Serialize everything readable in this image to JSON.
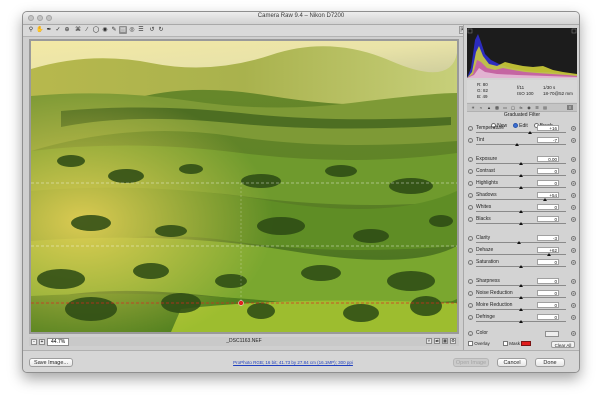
{
  "window": {
    "title": "Camera Raw 9.4  –  Nikon D7200"
  },
  "toolbar": {
    "tools": [
      "zoom-tool",
      "hand-tool",
      "white-balance-tool",
      "color-sampler-tool",
      "targeted-adjustment-tool",
      "crop-tool",
      "straighten-tool",
      "spot-removal-tool",
      "red-eye-tool",
      "adjustment-brush-tool",
      "graduated-filter-tool",
      "radial-filter-tool",
      "preferences-tool",
      "rotate-ccw-tool",
      "rotate-cw-tool"
    ],
    "active_tool": "graduated-filter-tool"
  },
  "status": {
    "zoom": "44.7%",
    "filename": "_DSC1163.NEF"
  },
  "info": {
    "r_label": "R:",
    "r_value": "80",
    "g_label": "G:",
    "g_value": "82",
    "b_label": "B:",
    "b_value": "49",
    "aperture": "f/11",
    "shutter": "1/30 s",
    "iso": "ISO 100",
    "lens": "18-70@52 mm"
  },
  "panel": {
    "title": "Graduated Filter",
    "modes": [
      {
        "label": "New",
        "selected": false
      },
      {
        "label": "Edit",
        "selected": true
      },
      {
        "label": "Brush",
        "selected": false
      }
    ],
    "sliders": [
      {
        "label": "Temperature",
        "value": "+16",
        "fraction": 0.6
      },
      {
        "label": "Tint",
        "value": "-7",
        "fraction": 0.46
      },
      {
        "label": "Exposure",
        "value": "0.00",
        "fraction": 0.5
      },
      {
        "label": "Contrast",
        "value": "0",
        "fraction": 0.5
      },
      {
        "label": "Highlights",
        "value": "0",
        "fraction": 0.5
      },
      {
        "label": "Shadows",
        "value": "+54",
        "fraction": 0.77
      },
      {
        "label": "Whites",
        "value": "0",
        "fraction": 0.5
      },
      {
        "label": "Blacks",
        "value": "0",
        "fraction": 0.5
      },
      {
        "label": "Clarity",
        "value": "-3",
        "fraction": 0.48
      },
      {
        "label": "Dehaze",
        "value": "+62",
        "fraction": 0.81
      },
      {
        "label": "Saturation",
        "value": "0",
        "fraction": 0.5
      },
      {
        "label": "Sharpness",
        "value": "0",
        "fraction": 0.5
      },
      {
        "label": "Noise Reduction",
        "value": "0",
        "fraction": 0.5
      },
      {
        "label": "Moire Reduction",
        "value": "0",
        "fraction": 0.5
      },
      {
        "label": "Defringe",
        "value": "0",
        "fraction": 0.5
      }
    ],
    "color_label": "Color",
    "overlay_label": "Overlay",
    "mask_label": "Mask",
    "clear_all_label": "Clear All",
    "mask_color": "#e21b1b"
  },
  "bottom": {
    "save_label": "Save Image...",
    "workflow_link": "ProPhoto RGB; 16 bit; 41.73 by 27.84 cm (16.1MP); 300 ppi",
    "open_label": "Open Image",
    "cancel_label": "Cancel",
    "done_label": "Done"
  },
  "colors": {
    "link": "#1f3fbf",
    "accent_radio": "#3b6fd4"
  }
}
